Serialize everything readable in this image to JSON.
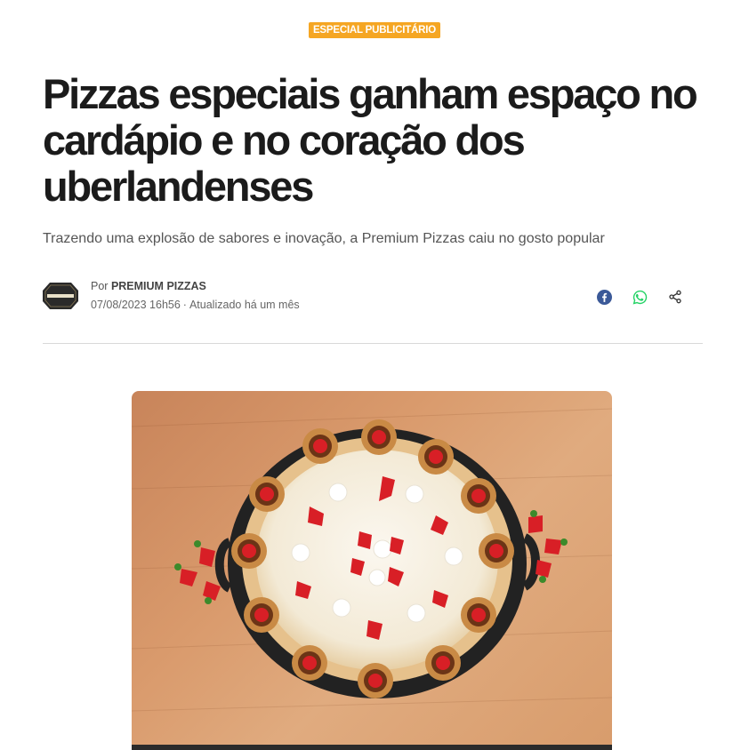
{
  "article": {
    "badge": "ESPECIAL PUBLICITÁRIO",
    "title": "Pizzas especiais ganham espaço no cardápio e no coração dos uberlandenses",
    "subtitle": "Trazendo uma explosão de sabores e inovação, a Premium Pizzas caiu no gosto popular",
    "author_prefix": "Por",
    "author_name": "PREMIUM PIZZAS",
    "avatar_text": "PREMIUM PIZZAS",
    "date": "07/08/2023 16h56",
    "separator": "·",
    "updated": "Atualizado há um mês"
  },
  "share": {
    "facebook_icon": "facebook-icon",
    "whatsapp_icon": "whatsapp-icon",
    "share_icon": "share-icon"
  },
  "colors": {
    "badge": "#f5a623",
    "facebook": "#3b5998",
    "whatsapp": "#25d366",
    "title": "#1b1b1b"
  },
  "image": {
    "subject": "pizza-photo"
  }
}
